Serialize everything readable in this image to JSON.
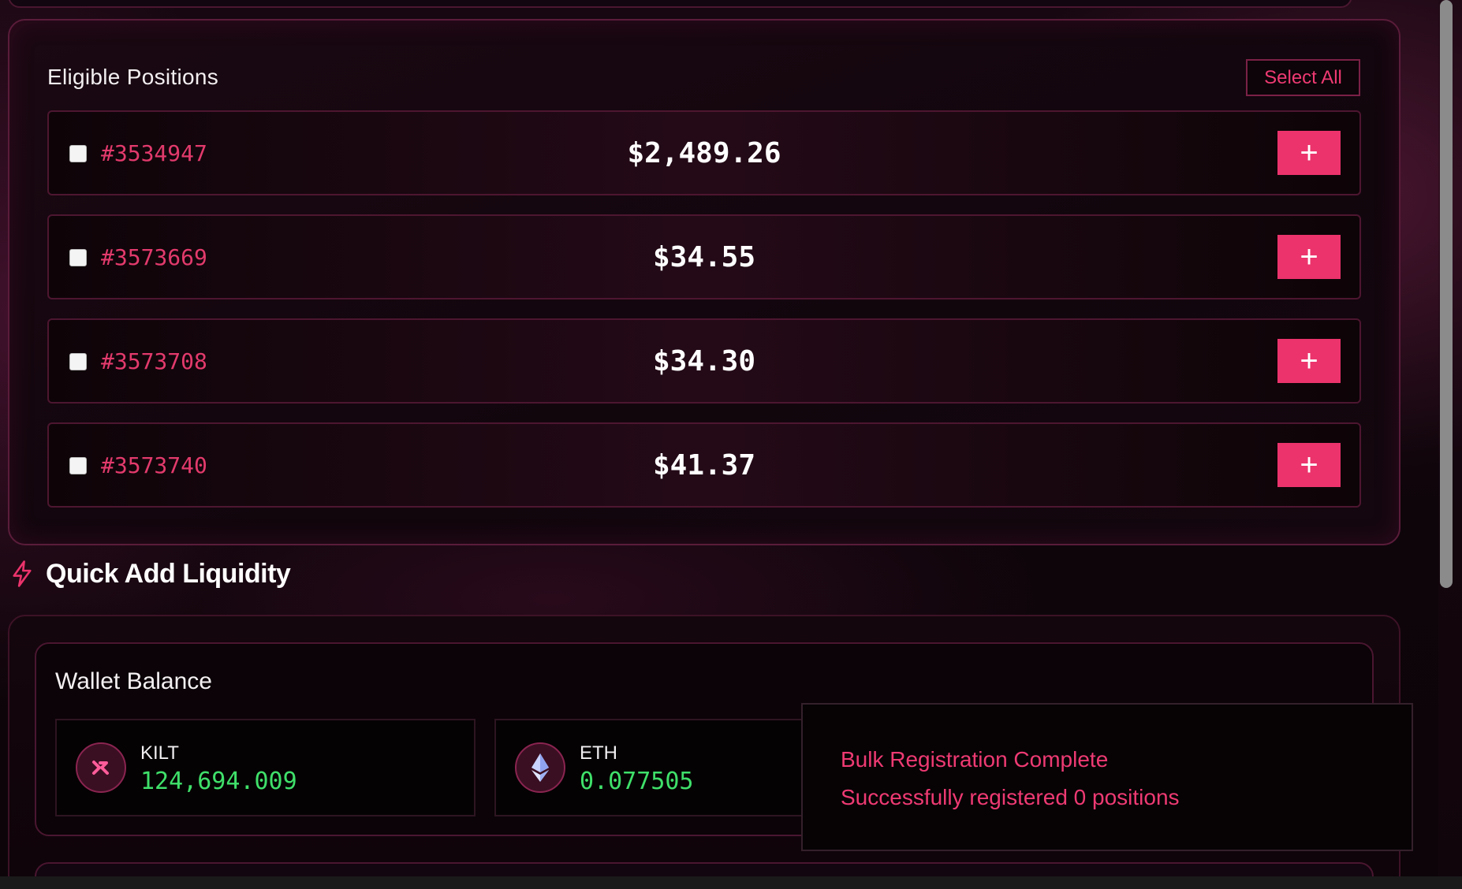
{
  "eligible": {
    "title": "Eligible Positions",
    "select_all_label": "Select All",
    "positions": [
      {
        "id": "#3534947",
        "value": "$2,489.26",
        "checked": false,
        "add_label": "+"
      },
      {
        "id": "#3573669",
        "value": "$34.55",
        "checked": false,
        "add_label": "+"
      },
      {
        "id": "#3573708",
        "value": "$34.30",
        "checked": false,
        "add_label": "+"
      },
      {
        "id": "#3573740",
        "value": "$41.37",
        "checked": false,
        "add_label": "+"
      }
    ]
  },
  "quick_add": {
    "title": "Quick Add Liquidity",
    "icon": "lightning-bolt-icon"
  },
  "wallet": {
    "title": "Wallet Balance",
    "tokens": [
      {
        "symbol": "KILT",
        "amount": "124,694.009",
        "icon": "kilt-token-icon"
      },
      {
        "symbol": "ETH",
        "amount": "0.077505",
        "icon": "eth-token-icon"
      }
    ]
  },
  "toast": {
    "title": "Bulk Registration Complete",
    "message": "Successfully registered 0 positions"
  },
  "colors": {
    "accent": "#ec336c",
    "accent_text": "#ee3a73",
    "amount_green": "#3fe06a",
    "background": "#0d0509"
  }
}
